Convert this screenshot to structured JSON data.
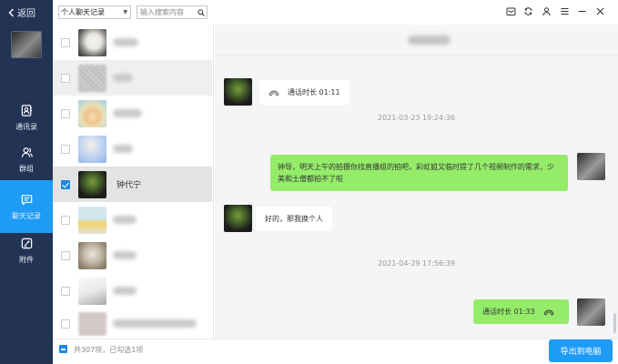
{
  "nav": {
    "back_label": "返回",
    "items": [
      {
        "label": "通讯录",
        "icon": "contacts-icon"
      },
      {
        "label": "群组",
        "icon": "group-icon"
      },
      {
        "label": "聊天记录",
        "icon": "chat-icon"
      },
      {
        "label": "附件",
        "icon": "attachment-icon"
      }
    ],
    "active": "聊天记录"
  },
  "list": {
    "filter_value": "个人聊天记录",
    "search_placeholder": "输入搜索内容",
    "selected_name": "钟代宁",
    "footer_count": "共307项，已勾选1项",
    "export_label": "导出到电脑"
  },
  "chat": {
    "messages": {
      "call_in": "通话时长 01:11",
      "ts1": "2021-03-23 19:24:36",
      "out_text": "钟导，明天上午的拍摄你找直播组的拍吧，彩虹姐又临时提了几个视频制作的需求，少美和土僧都拍不了啦",
      "reply": "好的，那我换个人",
      "ts2": "2021-04-29 17:56:39",
      "call_out": "通话时长 01:33"
    }
  },
  "colors": {
    "nav_bg": "#223353",
    "accent": "#1e9bf5",
    "bubble_out": "#95ec69"
  }
}
